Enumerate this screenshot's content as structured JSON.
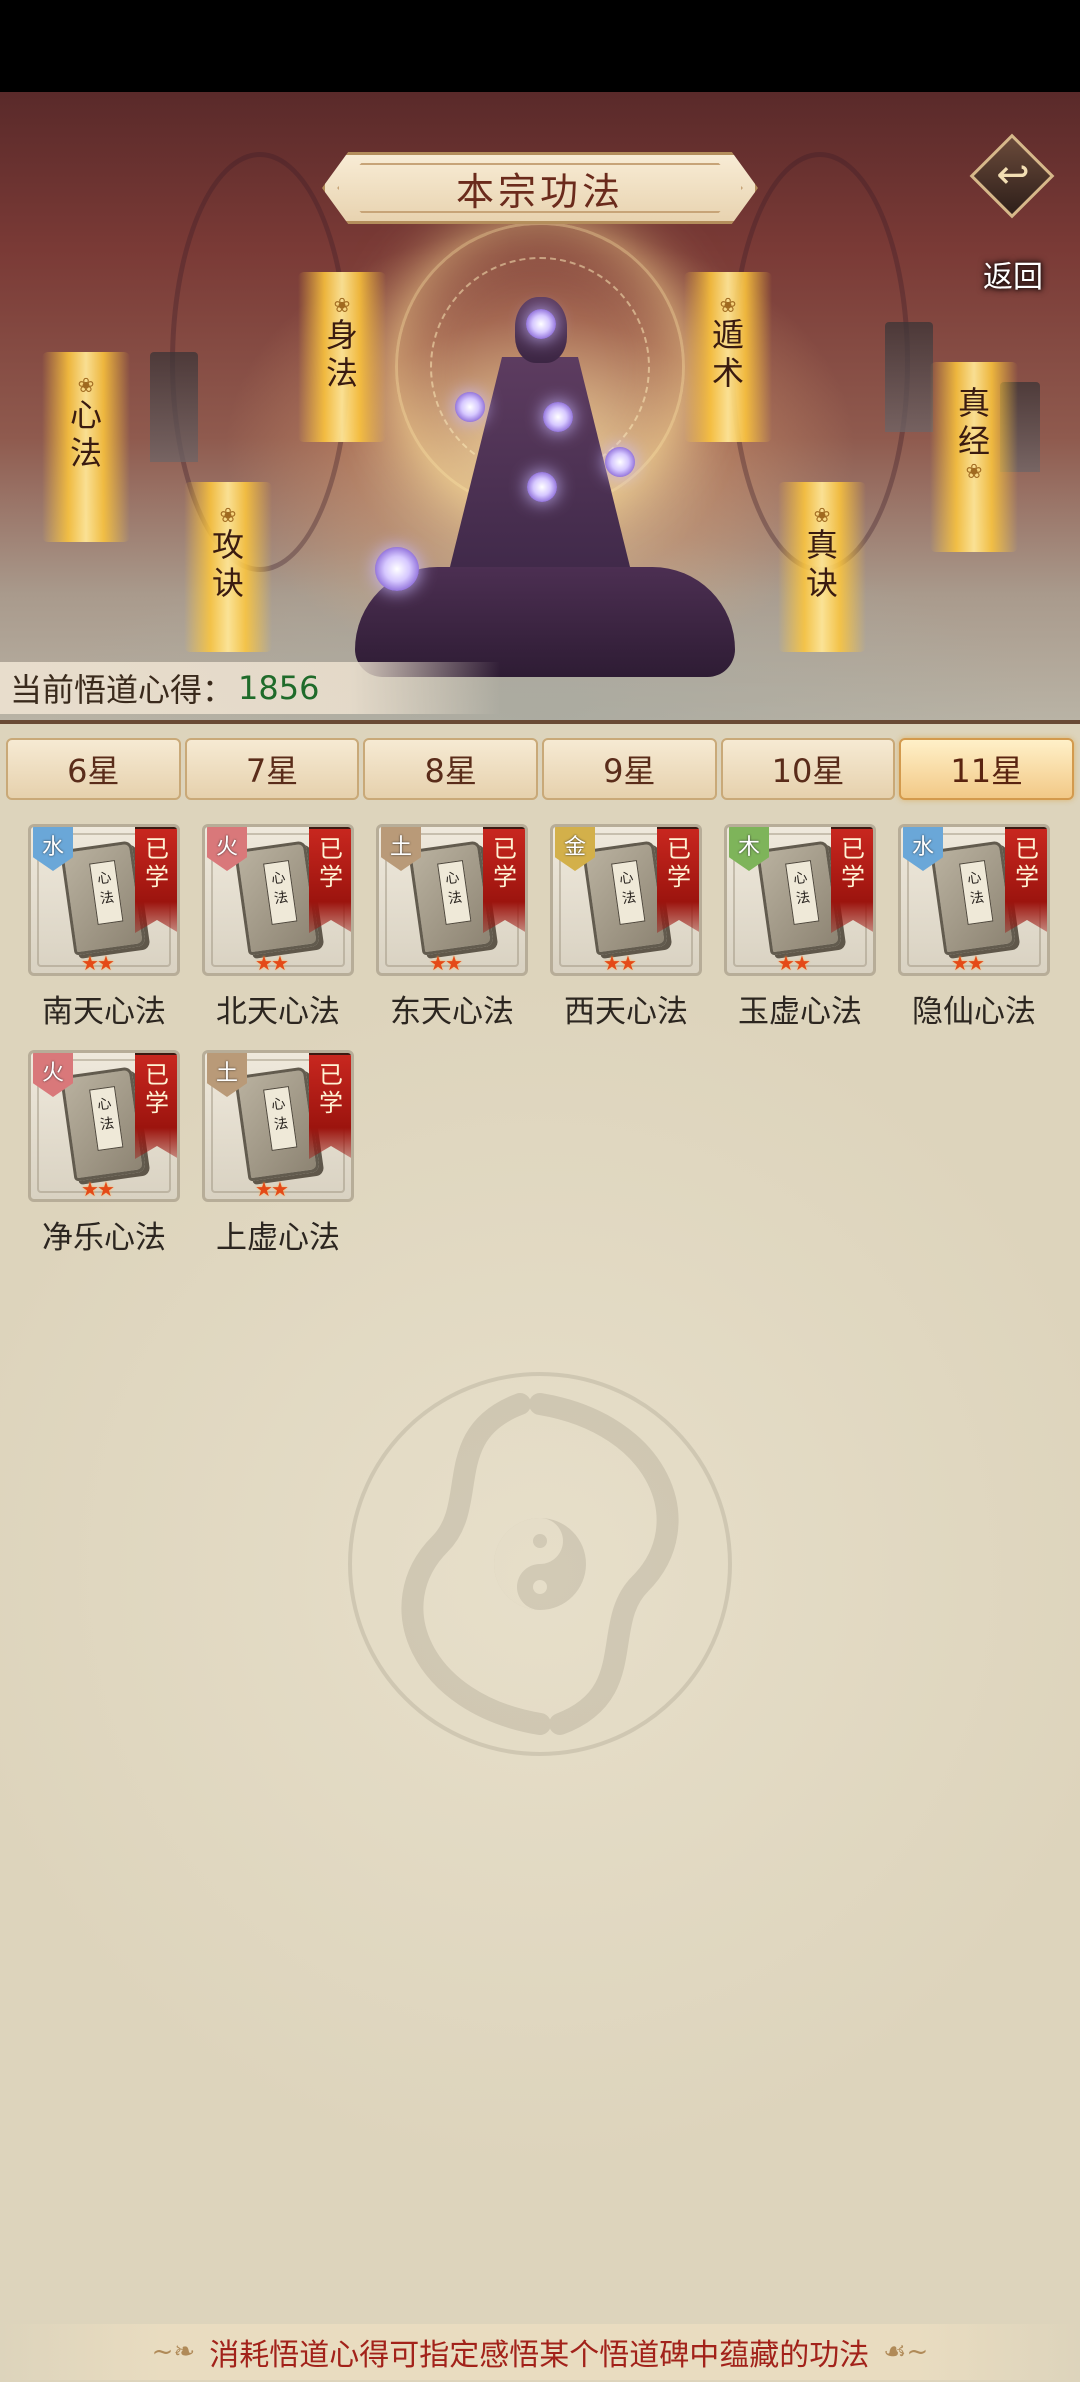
{
  "header": {
    "title": "本宗功法",
    "back_label": "返回"
  },
  "skill_categories": [
    {
      "label": "身法"
    },
    {
      "label": "遁术"
    },
    {
      "label": "心法"
    },
    {
      "label": "攻诀"
    },
    {
      "label": "真诀"
    },
    {
      "label": "真经"
    }
  ],
  "comprehension": {
    "label": "当前悟道心得：",
    "value": "1856"
  },
  "tabs": [
    {
      "label": "6星",
      "active": false
    },
    {
      "label": "7星",
      "active": false
    },
    {
      "label": "8星",
      "active": false
    },
    {
      "label": "9星",
      "active": false
    },
    {
      "label": "10星",
      "active": false
    },
    {
      "label": "11星",
      "active": true
    }
  ],
  "techniques": [
    {
      "name": "南天心法",
      "element": "水",
      "element_color": "#6aa7d8",
      "status": "已学",
      "stars": 2,
      "book_label": "心法"
    },
    {
      "name": "北天心法",
      "element": "火",
      "element_color": "#d9787a",
      "status": "已学",
      "stars": 2,
      "book_label": "心法"
    },
    {
      "name": "东天心法",
      "element": "土",
      "element_color": "#b99a78",
      "status": "已学",
      "stars": 2,
      "book_label": "心法"
    },
    {
      "name": "西天心法",
      "element": "金",
      "element_color": "#d3b04a",
      "status": "已学",
      "stars": 2,
      "book_label": "心法"
    },
    {
      "name": "玉虚心法",
      "element": "木",
      "element_color": "#7eb45a",
      "status": "已学",
      "stars": 2,
      "book_label": "心法"
    },
    {
      "name": "隐仙心法",
      "element": "水",
      "element_color": "#6aa7d8",
      "status": "已学",
      "stars": 2,
      "book_label": "心法"
    },
    {
      "name": "净乐心法",
      "element": "火",
      "element_color": "#d9787a",
      "status": "已学",
      "stars": 2,
      "book_label": "心法"
    },
    {
      "name": "上虚心法",
      "element": "土",
      "element_color": "#b99a78",
      "status": "已学",
      "stars": 2,
      "book_label": "心法"
    }
  ],
  "footer": {
    "hint": "消耗悟道心得可指定感悟某个悟道碑中蕴藏的功法",
    "ornament_left": "~❧",
    "ornament_right": "☙~"
  },
  "icons": {
    "back": "return-arrow-icon",
    "star": "★",
    "watermark": "dragon-yinyang-emblem"
  }
}
